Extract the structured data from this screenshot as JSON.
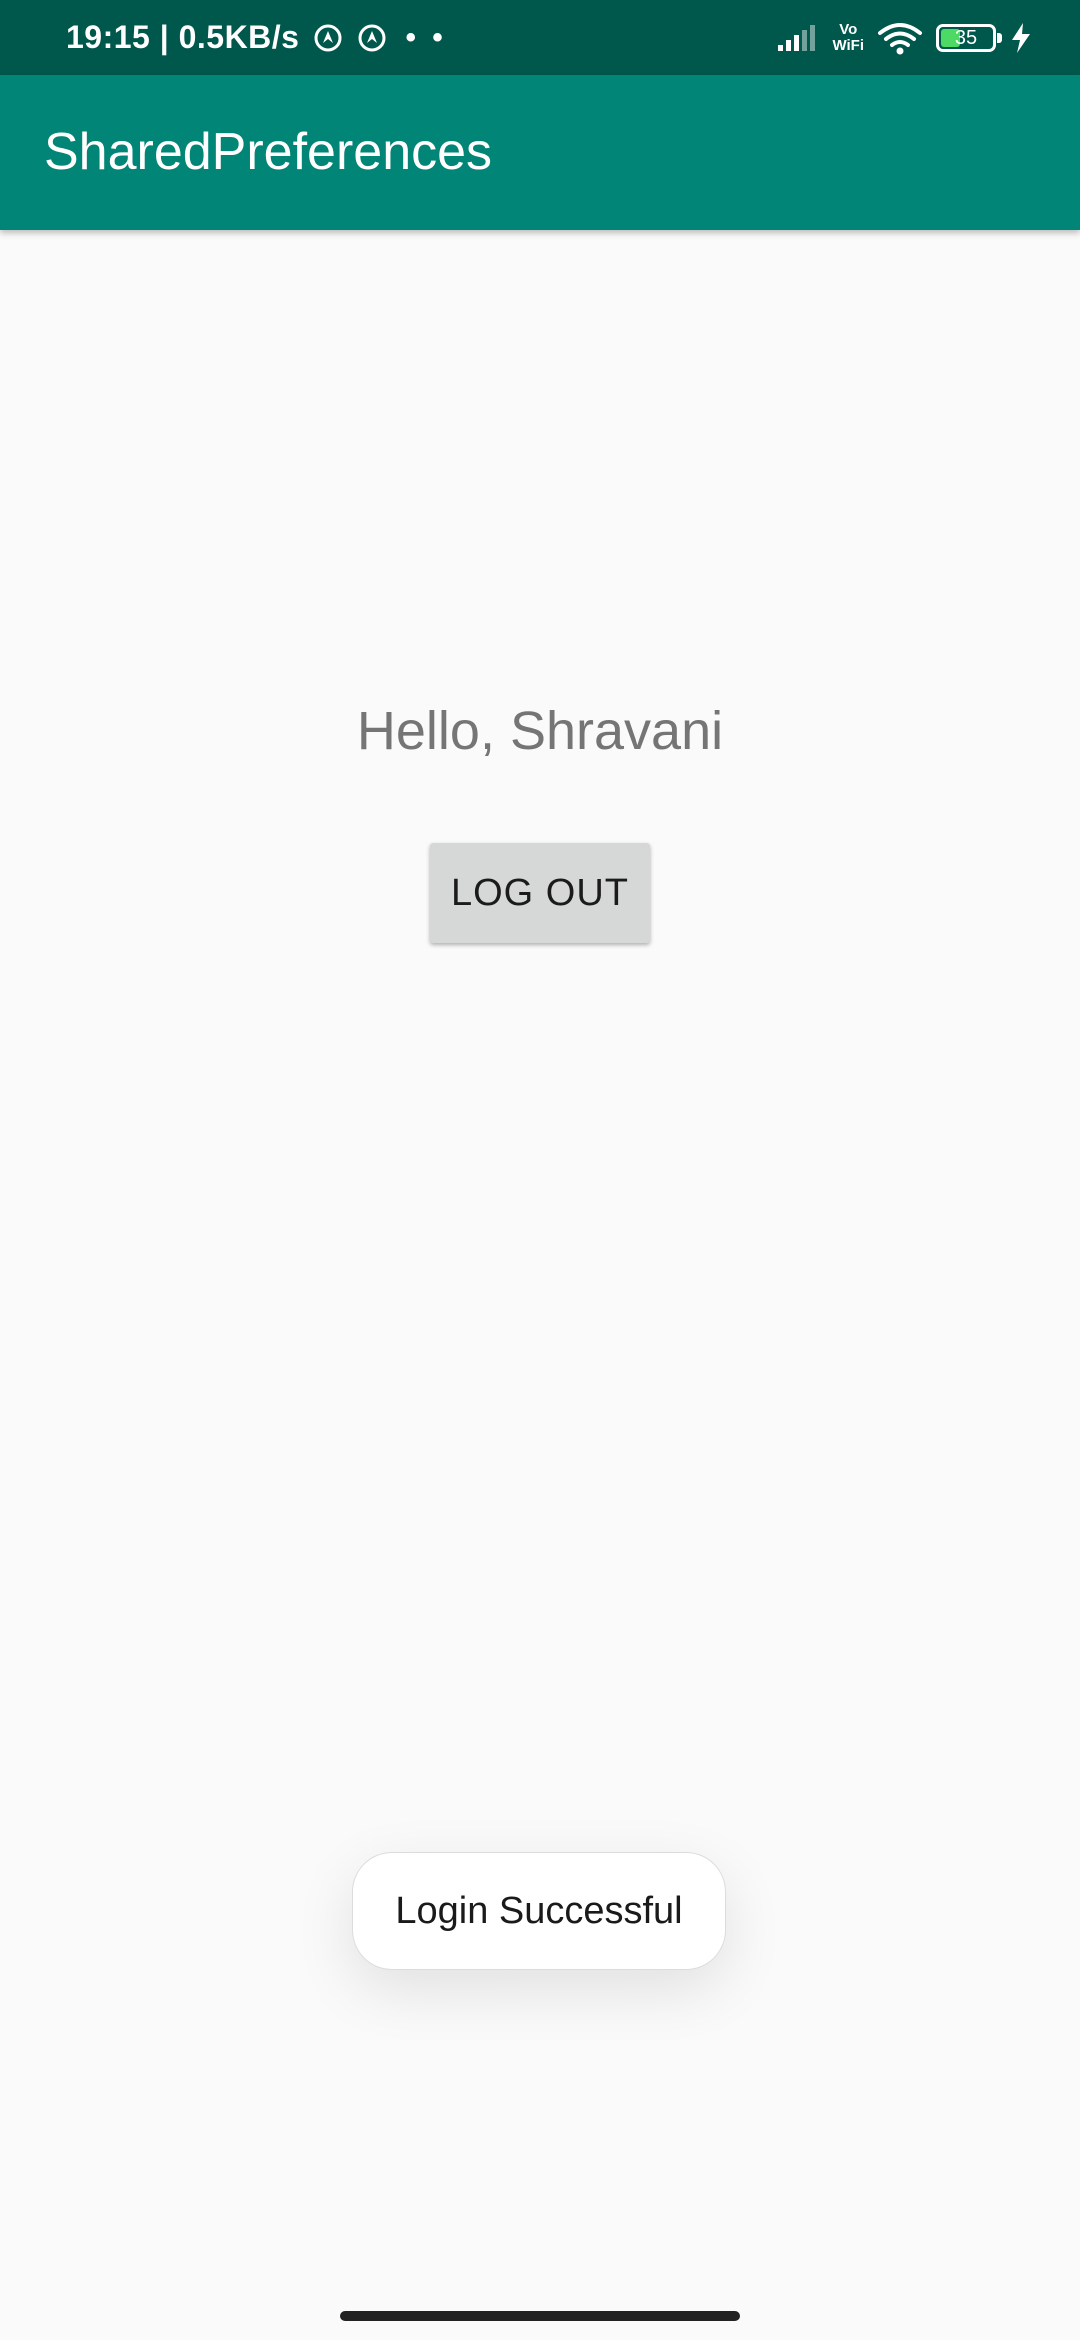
{
  "status_bar": {
    "time_speed": "19:15 | 0.5KB/s",
    "dots": "• •",
    "vowifi_top": "Vo",
    "vowifi_bottom": "WiFi",
    "battery_level": "35",
    "icons": [
      "location-circle-icon",
      "location-circle-icon",
      "signal-icon",
      "vowifi-icon",
      "wifi-icon",
      "battery-icon",
      "charging-bolt-icon"
    ]
  },
  "app_bar": {
    "title": "SharedPreferences",
    "color": "#008577"
  },
  "main": {
    "greeting": "Hello, Shravani",
    "logout_label": "LOG OUT"
  },
  "toast": {
    "message": "Login Successful"
  },
  "colors": {
    "status_bar": "#00574b",
    "app_bar": "#008577",
    "background": "#fafafa",
    "button": "#d6d7d7"
  }
}
